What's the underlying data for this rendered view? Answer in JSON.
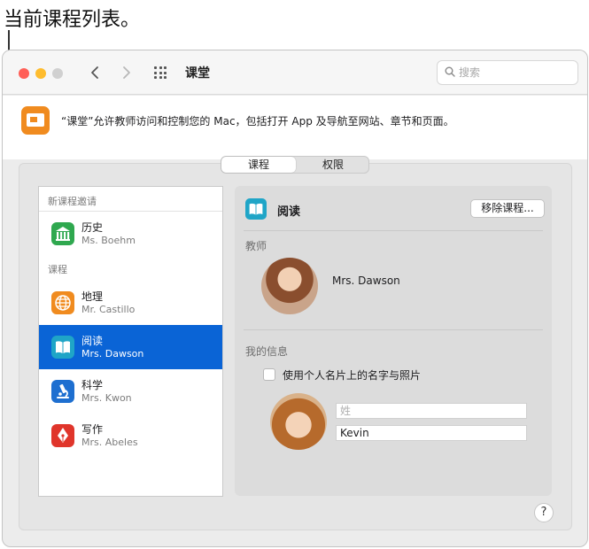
{
  "callout": {
    "title": "当前课程列表。"
  },
  "window": {
    "title": "课堂",
    "search_placeholder": "搜索"
  },
  "info": {
    "text": "“课堂”允许教师访问和控制您的 Mac，包括打开 App 及导航至网站、章节和页面。"
  },
  "tabs": [
    {
      "label": "课程",
      "selected": true
    },
    {
      "label": "权限",
      "selected": false
    }
  ],
  "sidebar": {
    "invite_section": "新课程邀请",
    "invites": [
      {
        "title": "历史",
        "subtitle": "Ms. Boehm",
        "icon": "columns-icon",
        "color": "#2fa84f"
      }
    ],
    "courses_section": "课程",
    "courses": [
      {
        "title": "地理",
        "subtitle": "Mr. Castillo",
        "icon": "globe-icon",
        "color": "#f08b1f",
        "selected": false
      },
      {
        "title": "阅读",
        "subtitle": "Mrs. Dawson",
        "icon": "book-icon",
        "color": "#1fa5c7",
        "selected": true
      },
      {
        "title": "科学",
        "subtitle": "Mrs. Kwon",
        "icon": "microscope-icon",
        "color": "#1e6fd0",
        "selected": false
      },
      {
        "title": "写作",
        "subtitle": "Mrs. Abeles",
        "icon": "pen-nib-icon",
        "color": "#e0352b",
        "selected": false
      }
    ]
  },
  "detail": {
    "course_title": "阅读",
    "remove_button": "移除课程...",
    "teacher_label": "教师",
    "teacher_name": "Mrs. Dawson",
    "my_info_label": "我的信息",
    "checkbox_label": "使用个人名片上的名字与照片",
    "last_name_placeholder": "姓",
    "first_name_value": "Kevin"
  },
  "help_label": "?",
  "colors": {
    "selection": "#0a64d6",
    "app_icon": "#f08b1f"
  }
}
